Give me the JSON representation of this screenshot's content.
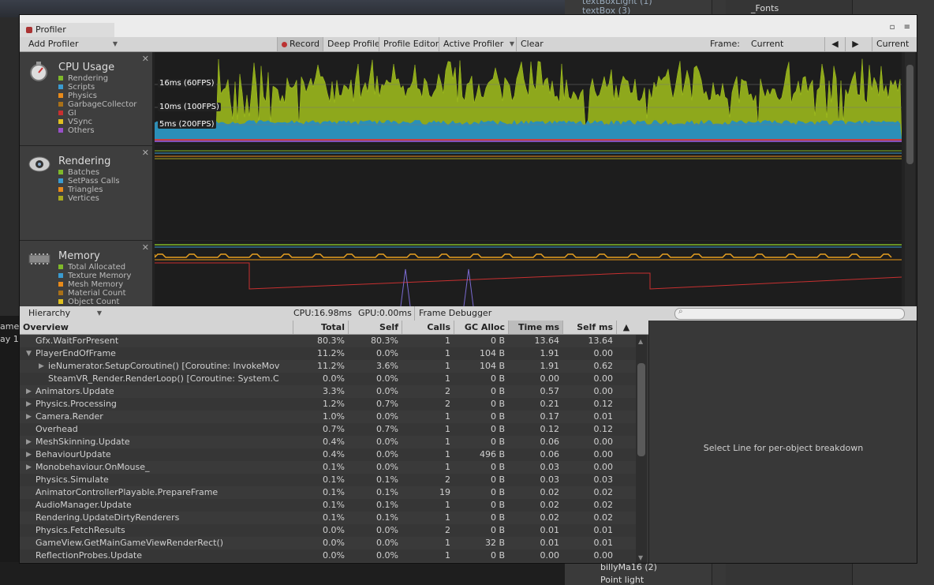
{
  "background": {
    "left_labels": [
      "ame",
      "ay 1"
    ],
    "right_top_items": [
      "textBoxLight (1)",
      "textBox (3)",
      "_Fonts"
    ],
    "right_bottom_items": [
      "billyMa16 (2)",
      "Point light"
    ]
  },
  "window": {
    "tab_label": "Profiler"
  },
  "toolbar": {
    "add_profiler": "Add Profiler",
    "record": "Record",
    "deep_profile": "Deep Profile",
    "profile_editor": "Profile Editor",
    "active_profiler": "Active Profiler",
    "clear": "Clear",
    "frame_label": "Frame:",
    "frame_value": "Current",
    "current_button": "Current"
  },
  "modules": {
    "cpu": {
      "title": "CPU Usage",
      "legend": [
        {
          "label": "Rendering",
          "color": "#7fb82a"
        },
        {
          "label": "Scripts",
          "color": "#3a9bd0"
        },
        {
          "label": "Physics",
          "color": "#e88a1a"
        },
        {
          "label": "GarbageCollector",
          "color": "#a87018"
        },
        {
          "label": "GI",
          "color": "#c83030"
        },
        {
          "label": "VSync",
          "color": "#e0c020"
        },
        {
          "label": "Others",
          "color": "#9850c8"
        }
      ],
      "fps_labels": [
        "16ms (60FPS)",
        "10ms (100FPS)",
        "5ms (200FPS)"
      ]
    },
    "rendering": {
      "title": "Rendering",
      "legend": [
        {
          "label": "Batches",
          "color": "#7fb82a"
        },
        {
          "label": "SetPass Calls",
          "color": "#3a9bd0"
        },
        {
          "label": "Triangles",
          "color": "#e88a1a"
        },
        {
          "label": "Vertices",
          "color": "#a8a820"
        }
      ]
    },
    "memory": {
      "title": "Memory",
      "legend": [
        {
          "label": "Total Allocated",
          "color": "#7fb82a"
        },
        {
          "label": "Texture Memory",
          "color": "#3a9bd0"
        },
        {
          "label": "Mesh Memory",
          "color": "#e88a1a"
        },
        {
          "label": "Material Count",
          "color": "#a87018"
        },
        {
          "label": "Object Count",
          "color": "#e0c020"
        }
      ]
    }
  },
  "hierarchy_bar": {
    "view_mode": "Hierarchy",
    "cpu": "CPU:16.98ms",
    "gpu": "GPU:0.00ms",
    "frame_debugger": "Frame Debugger"
  },
  "table": {
    "columns": [
      "Overview",
      "Total",
      "Self",
      "Calls",
      "GC Alloc",
      "Time ms",
      "Self ms"
    ],
    "rows": [
      {
        "name": "Gfx.WaitForPresent",
        "total": "80.3%",
        "self": "80.3%",
        "calls": "1",
        "gc": "0 B",
        "time": "13.64",
        "selfms": "13.64",
        "indent": 0,
        "arrow": ""
      },
      {
        "name": "PlayerEndOfFrame",
        "total": "11.2%",
        "self": "0.0%",
        "calls": "1",
        "gc": "104 B",
        "time": "1.91",
        "selfms": "0.00",
        "indent": 0,
        "arrow": "▼"
      },
      {
        "name": "ieNumerator.SetupCoroutine() [Coroutine: InvokeMov",
        "total": "11.2%",
        "self": "3.6%",
        "calls": "1",
        "gc": "104 B",
        "time": "1.91",
        "selfms": "0.62",
        "indent": 1,
        "arrow": "▶"
      },
      {
        "name": "SteamVR_Render.RenderLoop() [Coroutine: System.C",
        "total": "0.0%",
        "self": "0.0%",
        "calls": "1",
        "gc": "0 B",
        "time": "0.00",
        "selfms": "0.00",
        "indent": 1,
        "arrow": ""
      },
      {
        "name": "Animators.Update",
        "total": "3.3%",
        "self": "0.0%",
        "calls": "2",
        "gc": "0 B",
        "time": "0.57",
        "selfms": "0.00",
        "indent": 0,
        "arrow": "▶"
      },
      {
        "name": "Physics.Processing",
        "total": "1.2%",
        "self": "0.7%",
        "calls": "2",
        "gc": "0 B",
        "time": "0.21",
        "selfms": "0.12",
        "indent": 0,
        "arrow": "▶"
      },
      {
        "name": "Camera.Render",
        "total": "1.0%",
        "self": "0.0%",
        "calls": "1",
        "gc": "0 B",
        "time": "0.17",
        "selfms": "0.01",
        "indent": 0,
        "arrow": "▶"
      },
      {
        "name": "Overhead",
        "total": "0.7%",
        "self": "0.7%",
        "calls": "1",
        "gc": "0 B",
        "time": "0.12",
        "selfms": "0.12",
        "indent": 0,
        "arrow": ""
      },
      {
        "name": "MeshSkinning.Update",
        "total": "0.4%",
        "self": "0.0%",
        "calls": "1",
        "gc": "0 B",
        "time": "0.06",
        "selfms": "0.00",
        "indent": 0,
        "arrow": "▶"
      },
      {
        "name": "BehaviourUpdate",
        "total": "0.4%",
        "self": "0.0%",
        "calls": "1",
        "gc": "496 B",
        "time": "0.06",
        "selfms": "0.00",
        "indent": 0,
        "arrow": "▶"
      },
      {
        "name": "Monobehaviour.OnMouse_",
        "total": "0.1%",
        "self": "0.0%",
        "calls": "1",
        "gc": "0 B",
        "time": "0.03",
        "selfms": "0.00",
        "indent": 0,
        "arrow": "▶"
      },
      {
        "name": "Physics.Simulate",
        "total": "0.1%",
        "self": "0.1%",
        "calls": "2",
        "gc": "0 B",
        "time": "0.03",
        "selfms": "0.03",
        "indent": 0,
        "arrow": ""
      },
      {
        "name": "AnimatorControllerPlayable.PrepareFrame",
        "total": "0.1%",
        "self": "0.1%",
        "calls": "19",
        "gc": "0 B",
        "time": "0.02",
        "selfms": "0.02",
        "indent": 0,
        "arrow": ""
      },
      {
        "name": "AudioManager.Update",
        "total": "0.1%",
        "self": "0.1%",
        "calls": "1",
        "gc": "0 B",
        "time": "0.02",
        "selfms": "0.02",
        "indent": 0,
        "arrow": ""
      },
      {
        "name": "Rendering.UpdateDirtyRenderers",
        "total": "0.1%",
        "self": "0.1%",
        "calls": "1",
        "gc": "0 B",
        "time": "0.02",
        "selfms": "0.02",
        "indent": 0,
        "arrow": ""
      },
      {
        "name": "Physics.FetchResults",
        "total": "0.0%",
        "self": "0.0%",
        "calls": "2",
        "gc": "0 B",
        "time": "0.01",
        "selfms": "0.01",
        "indent": 0,
        "arrow": ""
      },
      {
        "name": "GameView.GetMainGameViewRenderRect()",
        "total": "0.0%",
        "self": "0.0%",
        "calls": "1",
        "gc": "32 B",
        "time": "0.01",
        "selfms": "0.01",
        "indent": 0,
        "arrow": ""
      },
      {
        "name": "ReflectionProbes.Update",
        "total": "0.0%",
        "self": "0.0%",
        "calls": "1",
        "gc": "0 B",
        "time": "0.00",
        "selfms": "0.00",
        "indent": 0,
        "arrow": ""
      }
    ]
  },
  "detail_panel": {
    "message": "Select Line for per-object breakdown"
  }
}
